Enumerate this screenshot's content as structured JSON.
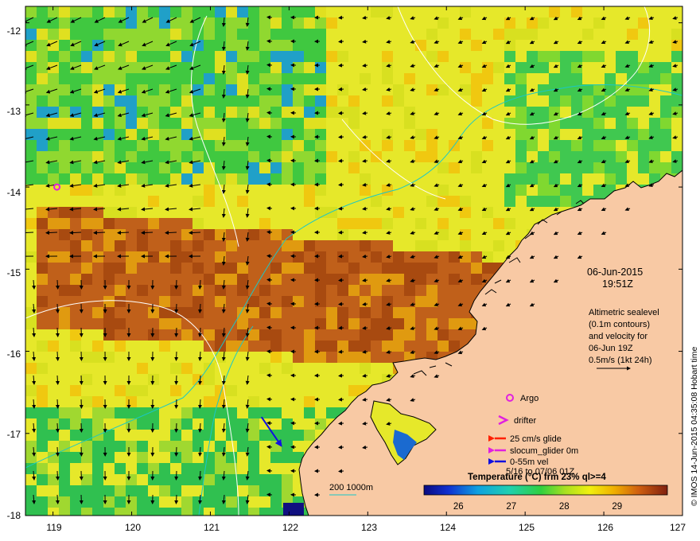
{
  "stamp": {
    "date": "06-Jun-2015",
    "time": "19:51Z"
  },
  "altimetry_note": [
    "Altimetric sealevel",
    "(0.1m contours)",
    "and velocity for",
    "06-Jun 19Z",
    "0.5m/s (1kt 24h)"
  ],
  "legend": {
    "argo": "Argo",
    "drifter": "drifter",
    "glide": "25 cm/s glide",
    "slocum": "slocum_glider 0m",
    "vel": "0-55m vel",
    "window": "5/16 to 07/06 01Z"
  },
  "isobath_label": "200  1000m",
  "colorbar": {
    "title": "Temperature (°C) frm 23% ql>=4",
    "ticks": [
      "26",
      "27",
      "28",
      "29"
    ],
    "tick_values": [
      26,
      27,
      28,
      29
    ],
    "range": [
      25.35,
      29.95
    ]
  },
  "credit": "© IMOS 14-Jun-2015 04:35:08 Hobart time",
  "axes": {
    "lon_ticks": [
      "119",
      "120",
      "121",
      "122",
      "123",
      "124",
      "125",
      "126",
      "127"
    ],
    "lat_ticks": [
      "-12",
      "-13",
      "-14",
      "-15",
      "-16",
      "-17",
      "-18"
    ],
    "lon_range": [
      118.65,
      127.0
    ],
    "lat_range": [
      -11.8,
      -18.0
    ]
  },
  "colors": {
    "land": "#f8c9a4",
    "coastline": "#000000",
    "contour": "#ffffff",
    "isobath": "#19c8c8",
    "argo": "#e020e0",
    "glide": "#ff2000",
    "slocum": "#e020e0",
    "vel": "#1010e0"
  },
  "features": {
    "argo_floats": [
      {
        "lon": 119.05,
        "lat": -14.0
      },
      {
        "lon": 124.85,
        "lat": -16.55
      }
    ],
    "velocity_vector": {
      "lon": 121.65,
      "lat": -16.8,
      "dlon": 0.25,
      "dlat": -0.35
    }
  }
}
